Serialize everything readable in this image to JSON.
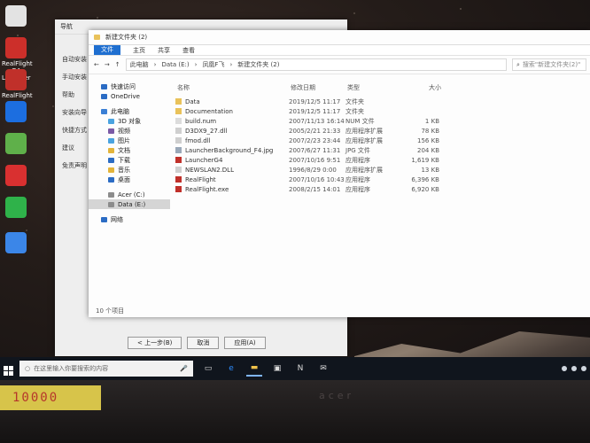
{
  "desktop": {
    "icons": [
      {
        "label": "",
        "color": "#e3e3e3",
        "icon": "app-icon"
      },
      {
        "label": "RealFlight G4 Launcher",
        "color": "#cc2f2a",
        "icon": "realflight-icon"
      },
      {
        "label": "RealFlight",
        "color": "#c0302a",
        "icon": "realflight-icon"
      },
      {
        "label": "",
        "color": "#1c6ee0",
        "icon": "shield-icon"
      },
      {
        "label": "",
        "color": "#5fb04a",
        "icon": "flower-icon"
      },
      {
        "label": "",
        "color": "#d93030",
        "icon": "app-icon"
      },
      {
        "label": "",
        "color": "#2fb24a",
        "icon": "wechat-icon"
      },
      {
        "label": "",
        "color": "#3b86e8",
        "icon": "cloud-icon"
      }
    ]
  },
  "dialog_window": {
    "title": "导航",
    "side_labels": [
      "自动安装",
      "手动安装",
      "帮助",
      "安装向导",
      "快捷方式",
      "建议",
      "免责声明"
    ],
    "buttons": [
      "< 上一步(B)",
      "取消",
      "应用(A)"
    ]
  },
  "explorer": {
    "title": "新建文件夹 (2)",
    "ribbon": {
      "file": "文件",
      "home": "主页",
      "share": "共享",
      "view": "查看"
    },
    "address_path": [
      "此电脑",
      "Data (E:)",
      "凤凰F飞",
      "新建文件夹 (2)"
    ],
    "search_placeholder": "搜索\"新建文件夹(2)\"",
    "nav": [
      {
        "label": "快速访问",
        "icon": "star-icon",
        "color": "#2b6cc4"
      },
      {
        "label": "OneDrive",
        "icon": "cloud-icon",
        "color": "#2b6cc4"
      },
      {
        "label": "此电脑",
        "icon": "computer-icon",
        "color": "#3a7fd5"
      },
      {
        "label": "3D 对象",
        "icon": "cube-icon",
        "color": "#4aa3e0"
      },
      {
        "label": "视频",
        "icon": "video-icon",
        "color": "#7b5aa6"
      },
      {
        "label": "图片",
        "icon": "picture-icon",
        "color": "#4aa3e0"
      },
      {
        "label": "文档",
        "icon": "document-icon",
        "color": "#e3b43b"
      },
      {
        "label": "下载",
        "icon": "download-icon",
        "color": "#2b6cc4"
      },
      {
        "label": "音乐",
        "icon": "music-icon",
        "color": "#e3b43b"
      },
      {
        "label": "桌面",
        "icon": "desktop-icon",
        "color": "#2b6cc4"
      },
      {
        "label": "Acer (C:)",
        "icon": "drive-icon",
        "color": "#8c8c8c"
      },
      {
        "label": "Data (E:)",
        "icon": "drive-icon",
        "color": "#8c8c8c",
        "selected": true
      },
      {
        "label": "网络",
        "icon": "network-icon",
        "color": "#2b6cc4"
      }
    ],
    "columns": {
      "name": "名称",
      "date": "修改日期",
      "type": "类型",
      "size": "大小"
    },
    "files": [
      {
        "name": "Data",
        "date": "2019/12/5 11:17",
        "type": "文件夹",
        "size": "",
        "icon": "folder-icon",
        "color": "#e9c25a"
      },
      {
        "name": "Documentation",
        "date": "2019/12/5 11:17",
        "type": "文件夹",
        "size": "",
        "icon": "folder-icon",
        "color": "#e9c25a"
      },
      {
        "name": "build.num",
        "date": "2007/11/13 16:14",
        "type": "NUM 文件",
        "size": "1 KB",
        "icon": "file-icon",
        "color": "#dcdcdc"
      },
      {
        "name": "D3DX9_27.dll",
        "date": "2005/2/21 21:33",
        "type": "应用程序扩展",
        "size": "78 KB",
        "icon": "dll-icon",
        "color": "#cfcfcf"
      },
      {
        "name": "fmod.dll",
        "date": "2007/2/23 23:44",
        "type": "应用程序扩展",
        "size": "156 KB",
        "icon": "dll-icon",
        "color": "#cfcfcf"
      },
      {
        "name": "LauncherBackground_F4.jpg",
        "date": "2007/6/27 11:31",
        "type": "JPG 文件",
        "size": "204 KB",
        "icon": "image-file-icon",
        "color": "#9aa8b8"
      },
      {
        "name": "LauncherG4",
        "date": "2007/10/16 9:51",
        "type": "应用程序",
        "size": "1,619 KB",
        "icon": "exe-icon",
        "color": "#c0302a"
      },
      {
        "name": "NEWSLAN2.DLL",
        "date": "1996/8/29 0:00",
        "type": "应用程序扩展",
        "size": "13 KB",
        "icon": "dll-icon",
        "color": "#cfcfcf"
      },
      {
        "name": "RealFlight",
        "date": "2007/10/16 10:43",
        "type": "应用程序",
        "size": "6,396 KB",
        "icon": "exe-icon",
        "color": "#c0302a"
      },
      {
        "name": "RealFlight.exe",
        "date": "2008/2/15 14:01",
        "type": "应用程序",
        "size": "6,920 KB",
        "icon": "exe-icon",
        "color": "#c0302a"
      }
    ],
    "status": "10 个项目"
  },
  "taskbar": {
    "search_placeholder": "在这里输入你要搜索的内容",
    "apps": [
      "task-view-icon",
      "edge-icon",
      "file-explorer-icon",
      "store-icon",
      "notion-icon",
      "mail-icon"
    ]
  },
  "sticker_text": "10000",
  "brand": "acer"
}
